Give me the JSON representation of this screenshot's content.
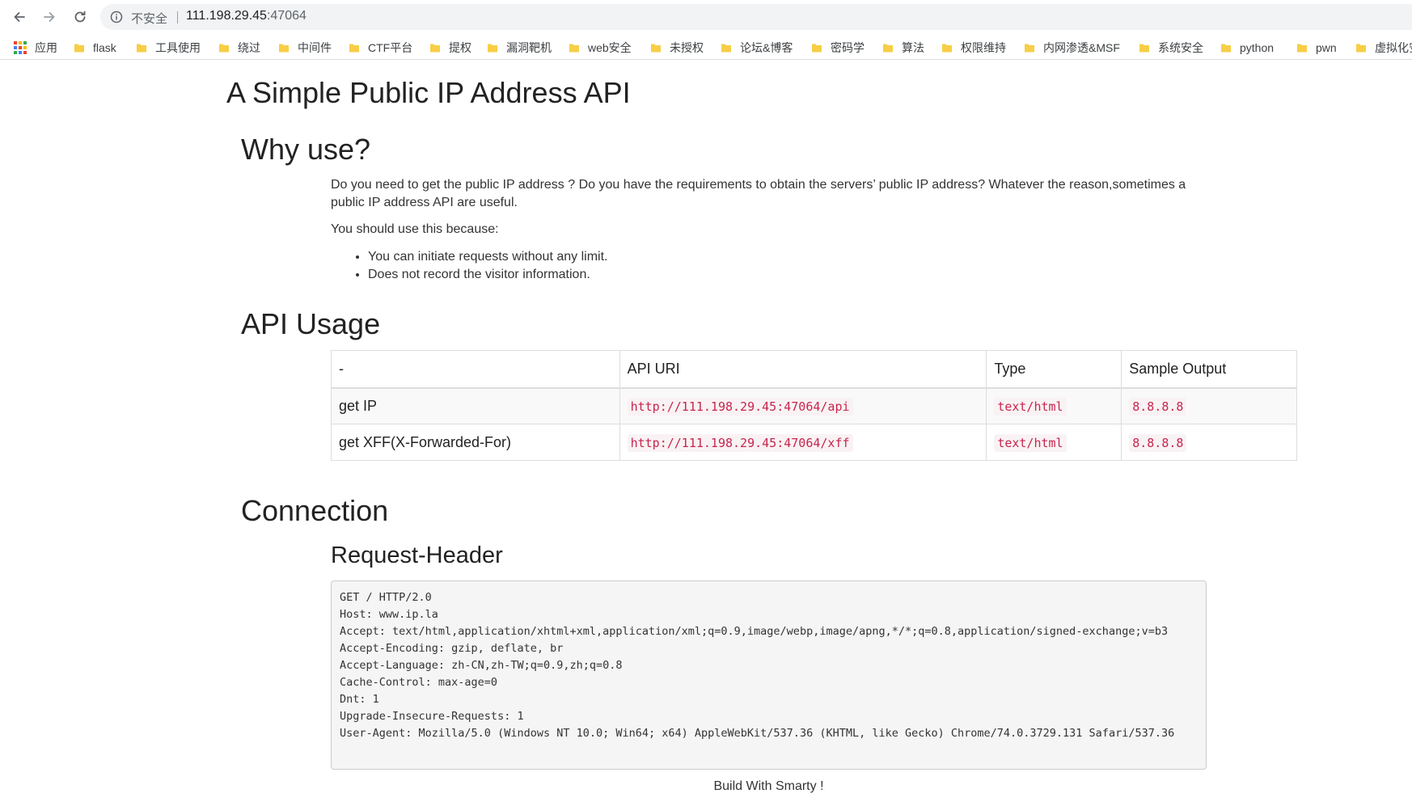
{
  "browser": {
    "security_label": "不安全",
    "url_host": "111.198.29.45",
    "url_port": ":47064",
    "bookmarks": [
      "应用",
      "flask",
      "工具使用",
      "绕过",
      "中间件",
      "CTF平台",
      "提权",
      "漏洞靶机",
      "web安全",
      "未授权",
      "论坛&博客",
      "密码学",
      "算法",
      "权限维持",
      "内网渗透&MSF",
      "系统安全",
      "python",
      "pwn",
      "虚拟化安"
    ]
  },
  "page": {
    "title": "A Simple Public IP Address API",
    "why": {
      "heading": "Why use?",
      "paragraph": "Do you need to get the public IP address ? Do you have the requirements to obtain the servers’ public IP address? Whatever the reason,sometimes a public IP address API are useful.",
      "intro": "You should use this because:",
      "reasons": [
        "You can initiate requests without any limit.",
        "Does not record the visitor information."
      ]
    },
    "usage": {
      "heading": "API Usage",
      "columns": [
        "-",
        "API URI",
        "Type",
        "Sample Output"
      ],
      "rows": [
        [
          "get IP",
          "http://111.198.29.45:47064/api",
          "text/html",
          "8.8.8.8"
        ],
        [
          "get XFF(X-Forwarded-For)",
          "http://111.198.29.45:47064/xff",
          "text/html",
          "8.8.8.8"
        ]
      ]
    },
    "connection": {
      "heading": "Connection",
      "subheading": "Request-Header",
      "header_lines": [
        "GET / HTTP/2.0",
        "Host: www.ip.la",
        "Accept: text/html,application/xhtml+xml,application/xml;q=0.9,image/webp,image/apng,*/*;q=0.8,application/signed-exchange;v=b3",
        "Accept-Encoding: gzip, deflate, br",
        "Accept-Language: zh-CN,zh-TW;q=0.9,zh;q=0.8",
        "Cache-Control: max-age=0",
        "Dnt: 1",
        "Upgrade-Insecure-Requests: 1",
        "User-Agent: Mozilla/5.0 (Windows NT 10.0; Win64; x64) AppleWebKit/537.36 (KHTML, like Gecko) Chrome/74.0.3729.131 Safari/537.36"
      ]
    },
    "footer": "Build With Smarty !"
  },
  "colors": {
    "code_text": "#c7254e",
    "code_bg": "#f9f2f4",
    "folder": "#f7ce46",
    "apps_grid": [
      "#ea4335",
      "#fbbc04",
      "#34a853",
      "#4285f4"
    ]
  }
}
